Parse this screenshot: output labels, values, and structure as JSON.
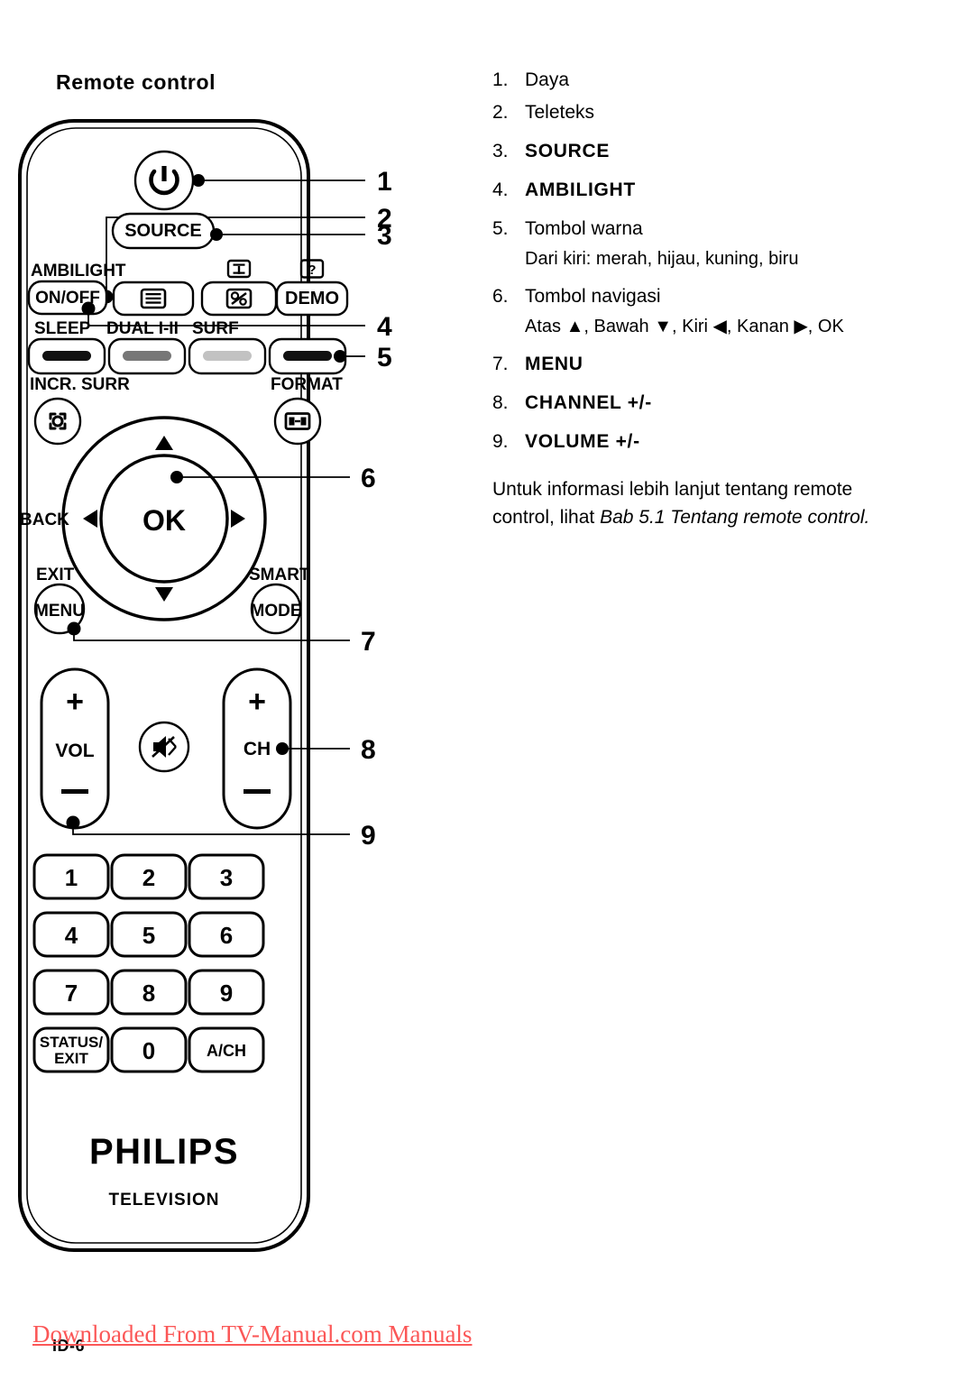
{
  "page": {
    "title": "Remote control",
    "page_number": "ID-6",
    "watermark": "Downloaded From TV-Manual.com Manuals",
    "watermark_color": "#fb5757"
  },
  "legend": {
    "items": [
      {
        "num": "1.",
        "label": "Daya",
        "bold": false,
        "sub": ""
      },
      {
        "num": "2.",
        "label": "Teleteks",
        "bold": false,
        "sub": ""
      },
      {
        "num": "3.",
        "label": "SOURCE",
        "bold": true,
        "sub": ""
      },
      {
        "num": "4.",
        "label": "AMBILIGHT",
        "bold": true,
        "sub": ""
      },
      {
        "num": "5.",
        "label": "Tombol warna",
        "bold": false,
        "sub": "Dari kiri: merah, hijau, kuning, biru"
      },
      {
        "num": "6.",
        "label": "Tombol navigasi",
        "bold": false,
        "sub": "Atas ▲, Bawah ▼, Kiri ◀, Kanan ▶, OK"
      },
      {
        "num": "7.",
        "label": "MENU",
        "bold": true,
        "sub": ""
      },
      {
        "num": "8.",
        "label": "CHANNEL +/-",
        "bold": true,
        "sub": ""
      },
      {
        "num": "9.",
        "label": "VOLUME +/-",
        "bold": true,
        "sub": ""
      }
    ]
  },
  "note": {
    "line1": "Untuk informasi lebih lanjut tentang remote",
    "line2_plain": "control, lihat ",
    "line2_italic": "Bab 5.1 Tentang remote control."
  },
  "remote": {
    "brand": "PHILIPS",
    "brand_sub": "TELEVISION",
    "buttons": {
      "power": "power-icon",
      "source": "SOURCE",
      "ambilight_label": "AMBILIGHT",
      "ambilight_onoff": "ON/OFF",
      "teletext": "teletext-icon",
      "subtitle_top": "subtitle-icon",
      "subtitle": "subtitle-page-icon",
      "demo_top": "info-question-icon",
      "demo": "DEMO",
      "sleep": "SLEEP",
      "dual": "DUAL I-II",
      "surf": "SURF",
      "incr_surr": "INCR. SURR",
      "format": "FORMAT",
      "back": "BACK",
      "ok": "OK",
      "exit": "EXIT",
      "menu": "MENU",
      "smart": "SMART",
      "mode": "MODE",
      "vol": "VOL",
      "ch": "CH",
      "plus": "+",
      "minus": "−",
      "mute": "mute-icon",
      "status_exit_1": "STATUS/",
      "status_exit_2": "EXIT",
      "ach": "A/CH",
      "keypad": [
        "1",
        "2",
        "3",
        "4",
        "5",
        "6",
        "7",
        "8",
        "9",
        "0"
      ]
    },
    "color_buttons": [
      {
        "name": "red-color-button",
        "fill": "#111111"
      },
      {
        "name": "green-color-button",
        "fill": "#777777"
      },
      {
        "name": "yellow-color-button",
        "fill": "#c2c2c2"
      },
      {
        "name": "blue-color-button",
        "fill": "#111111"
      }
    ],
    "callouts": [
      "1",
      "2",
      "3",
      "4",
      "5",
      "6",
      "7",
      "8",
      "9"
    ]
  }
}
